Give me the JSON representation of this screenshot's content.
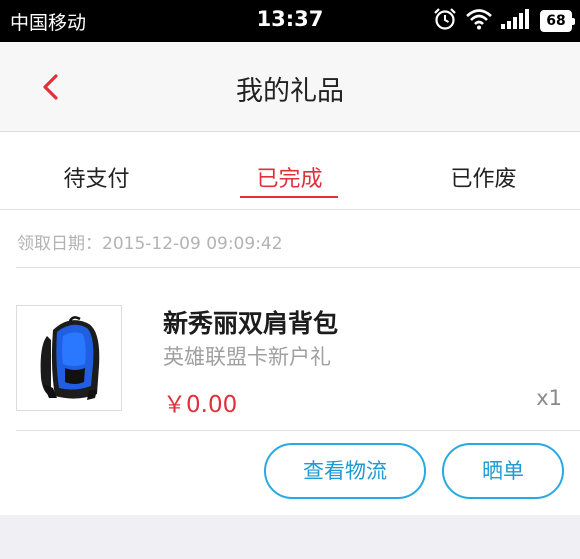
{
  "status_bar": {
    "carrier": "中国移动",
    "time": "13:37",
    "battery": "68"
  },
  "nav": {
    "title": "我的礼品",
    "back_icon": "chevron-left-icon"
  },
  "tabs": [
    {
      "label": "待支付",
      "active": false
    },
    {
      "label": "已完成",
      "active": true
    },
    {
      "label": "已作废",
      "active": false
    }
  ],
  "order": {
    "date": "领取日期：2015-12-09 09:09:42",
    "product_name": "新秀丽双肩背包",
    "product_desc": "英雄联盟卡新户礼",
    "price": "￥0.00",
    "quantity": "x1",
    "image": "backpack-image",
    "actions": {
      "logistics": "查看物流",
      "share": "晒单"
    }
  },
  "colors": {
    "accent_red": "#e0303a",
    "button_blue": "#29a9e1"
  }
}
